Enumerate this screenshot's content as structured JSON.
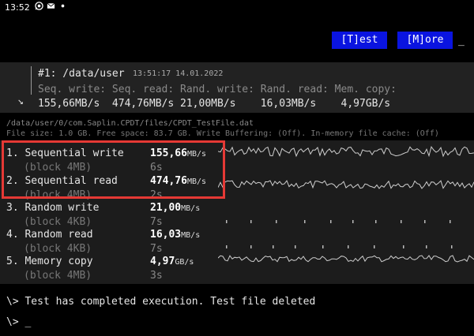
{
  "status_bar": {
    "time": "13:52"
  },
  "toolbar": {
    "test_label": "[T]est",
    "more_label": "[M]ore",
    "cursor": "_"
  },
  "summary": {
    "title": "#1: /data/user",
    "timestamp": "13:51:17 14.01.2022",
    "headers": "Seq. write: Seq. read: Rand. write: Rand. read: Mem. copy:",
    "values": "155,66MB/s  474,76MB/s 21,00MB/s    16,03MB/s    4,97GB/s",
    "arrow": "↘"
  },
  "file_path": "/data/user/0/com.Saplin.CPDT/files/CPDT_TestFile.dat",
  "file_info": "File size: 1.0 GB. Free space: 83.7 GB. Write Buffering: (Off). In-memory file cache: (Off)",
  "results": [
    {
      "name": "1. Sequential write",
      "block": "(block 4MB)",
      "value": "155,66",
      "unit": "MB/s",
      "time": "6s"
    },
    {
      "name": "2. Sequential read",
      "block": "(block 4MB)",
      "value": "474,76",
      "unit": "MB/s",
      "time": "2s"
    },
    {
      "name": "3. Random write",
      "block": "(block 4KB)",
      "value": "21,00",
      "unit": "MB/s",
      "time": "7s"
    },
    {
      "name": "4. Random read",
      "block": "(block 4KB)",
      "value": "16,03",
      "unit": "MB/s",
      "time": "7s"
    },
    {
      "name": "5. Memory copy",
      "block": "(block 4MB)",
      "value": "4,97",
      "unit": "GB/s",
      "time": "3s"
    }
  ],
  "log": {
    "message": "\\> Test has completed execution. Test file deleted",
    "prompt": "\\> _"
  },
  "colors": {
    "button": "#0a14e0",
    "highlight": "#e53935",
    "panel": "#222222"
  }
}
